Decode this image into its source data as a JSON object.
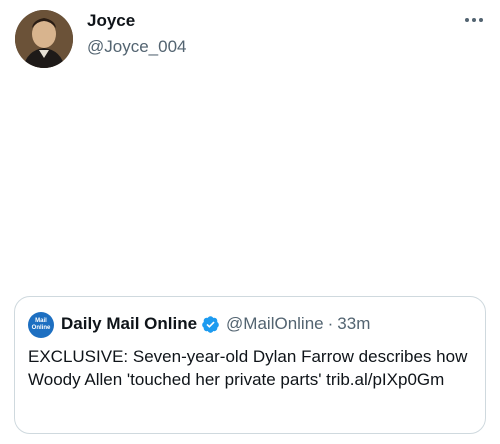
{
  "author": {
    "display_name": "Joyce",
    "handle": "@Joyce_004"
  },
  "tweet": {
    "text": ""
  },
  "icons": {
    "more": "more-horizontal-icon",
    "verified": "verified-badge-icon"
  },
  "quote": {
    "avatar_label_top": "Mail",
    "avatar_label_bottom": "Online",
    "display_name": "Daily Mail Online",
    "handle": "@MailOnline",
    "separator": "·",
    "time": "33m",
    "text": "EXCLUSIVE: Seven-year-old Dylan Farrow describes how Woody Allen 'touched her private parts' trib.al/pIXp0Gm"
  },
  "colors": {
    "primary_text": "#0f1419",
    "secondary_text": "#536471",
    "verified_blue": "#1d9bf0",
    "card_border": "#cfd9de",
    "quote_avatar_bg": "#1d6fc1"
  }
}
